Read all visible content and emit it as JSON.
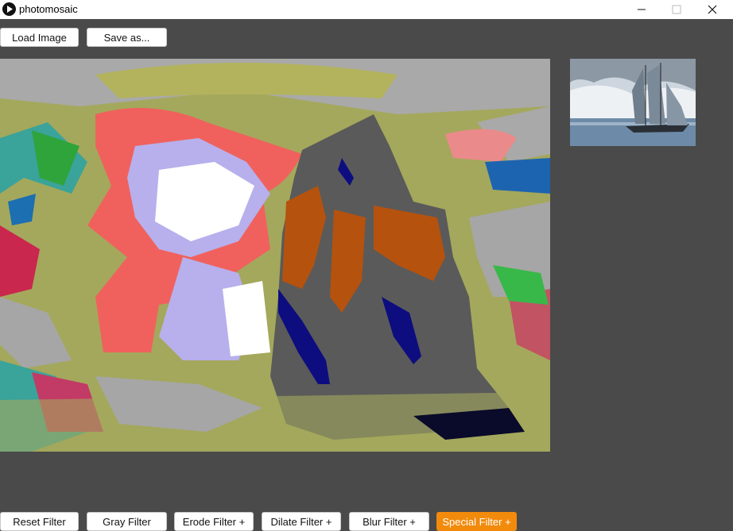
{
  "window": {
    "title": "photomosaic",
    "controls": [
      "minimize",
      "maximize",
      "close"
    ]
  },
  "toolbar": {
    "load_label": "Load Image",
    "save_label": "Save as..."
  },
  "filters": {
    "reset_label": "Reset Filter",
    "gray_label": "Gray Filter",
    "erode_label": "Erode Filter +",
    "dilate_label": "Dilate Filter +",
    "blur_label": "Blur Filter +",
    "special_label": "Special Filter +"
  },
  "colors": {
    "background": "#4a4a4a",
    "accent": "#f28a0c",
    "titlebar": "#ffffff"
  },
  "icons": {
    "app": "play-circle-icon",
    "minimize": "minimize-icon",
    "maximize": "maximize-icon",
    "close": "close-icon"
  }
}
